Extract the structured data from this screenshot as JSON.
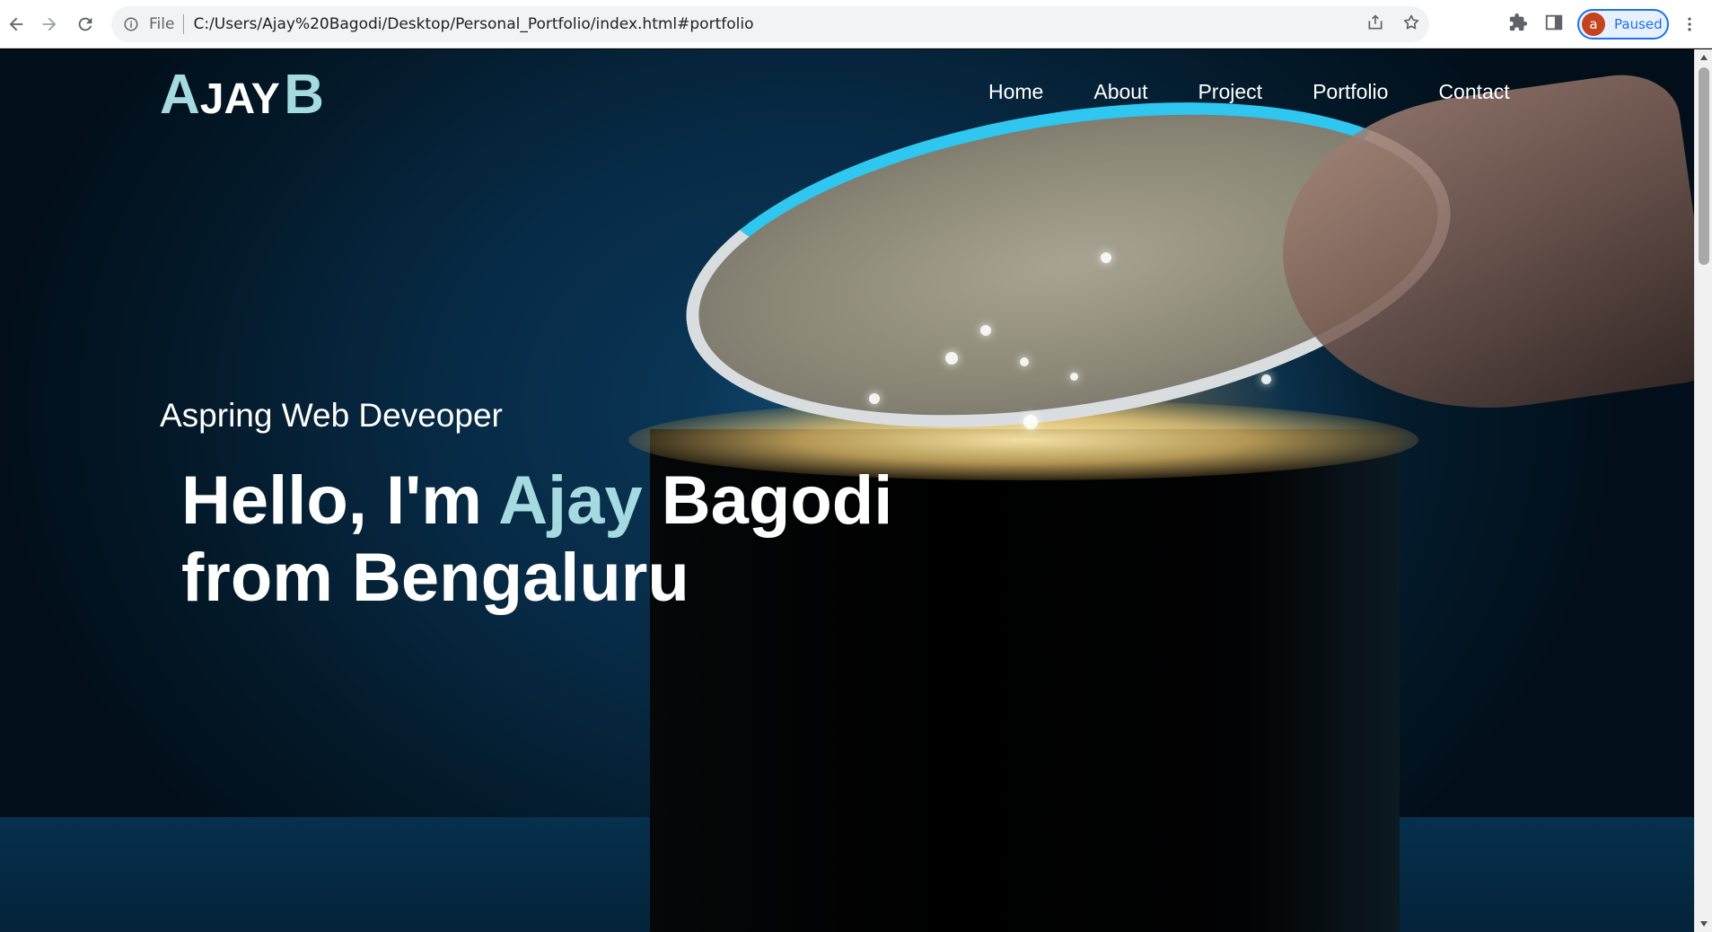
{
  "browser": {
    "omnibox": {
      "scheme_label": "File",
      "url": "C:/Users/Ajay%20Bagodi/Desktop/Personal_Portfolio/index.html#portfolio"
    },
    "profile": {
      "initial": "a",
      "status": "Paused"
    },
    "icons": {
      "back": "arrow-left-icon",
      "forward": "arrow-right-icon",
      "reload": "reload-icon",
      "info": "info-icon",
      "share": "share-icon",
      "bookmark": "star-icon",
      "extensions": "puzzle-icon",
      "side_panel": "side-panel-icon",
      "menu": "kebab-menu-icon"
    }
  },
  "site": {
    "logo": {
      "first_initial": "A",
      "first_rest": "JAY",
      "last": "B"
    },
    "nav": [
      {
        "label": "Home"
      },
      {
        "label": "About"
      },
      {
        "label": "Project"
      },
      {
        "label": "Portfolio"
      },
      {
        "label": "Contact"
      }
    ],
    "hero": {
      "subtitle": "Aspring Web Deveoper",
      "greeting": "Hello, I'm",
      "first_name": "Ajay",
      "last_name": "Bagodi",
      "location_line": "from Bengaluru"
    }
  },
  "colors": {
    "accent": "#a5dbe0",
    "background_dark": "#031827",
    "glow": "#ffd678",
    "browser_accent": "#1a73e8",
    "avatar": "#c4421e"
  }
}
